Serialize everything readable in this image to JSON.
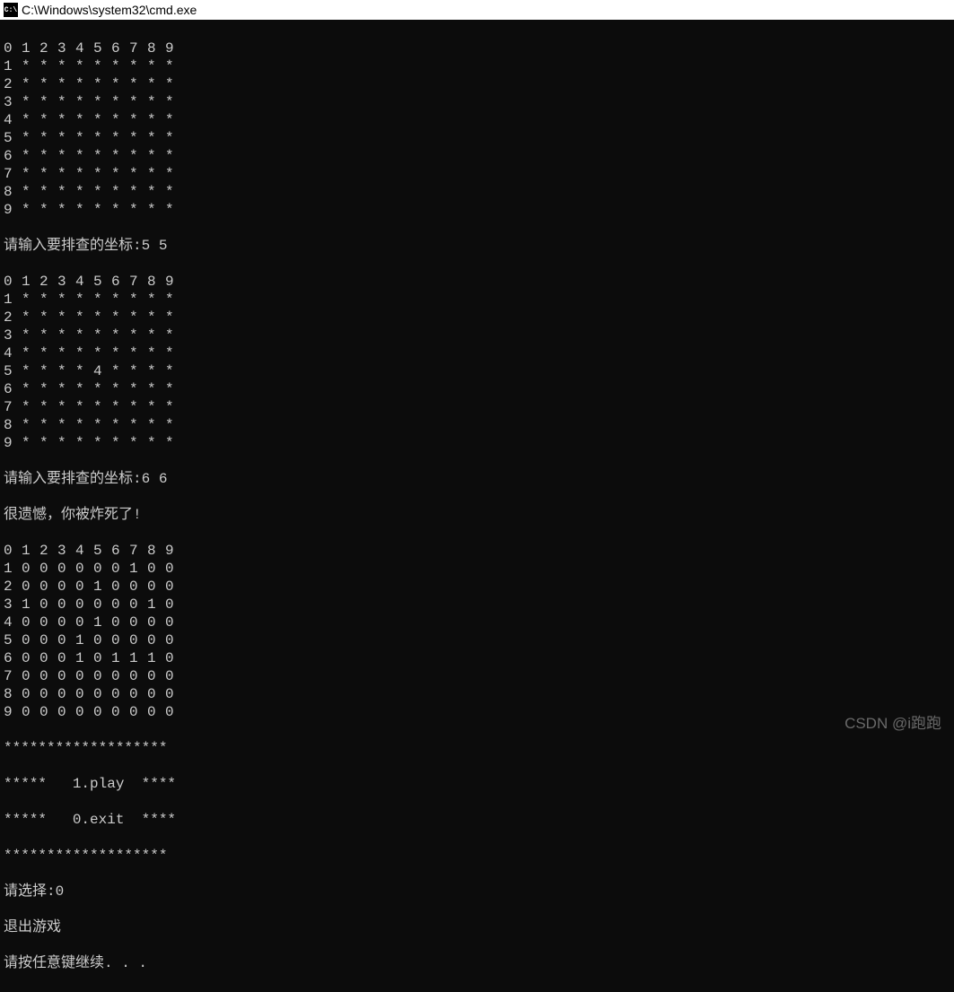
{
  "window": {
    "title": "C:\\Windows\\system32\\cmd.exe",
    "icon_label": "C:\\"
  },
  "grid1": {
    "header": [
      "0",
      "1",
      "2",
      "3",
      "4",
      "5",
      "6",
      "7",
      "8",
      "9"
    ],
    "rows": [
      [
        "1",
        "*",
        "*",
        "*",
        "*",
        "*",
        "*",
        "*",
        "*",
        "*"
      ],
      [
        "2",
        "*",
        "*",
        "*",
        "*",
        "*",
        "*",
        "*",
        "*",
        "*"
      ],
      [
        "3",
        "*",
        "*",
        "*",
        "*",
        "*",
        "*",
        "*",
        "*",
        "*"
      ],
      [
        "4",
        "*",
        "*",
        "*",
        "*",
        "*",
        "*",
        "*",
        "*",
        "*"
      ],
      [
        "5",
        "*",
        "*",
        "*",
        "*",
        "*",
        "*",
        "*",
        "*",
        "*"
      ],
      [
        "6",
        "*",
        "*",
        "*",
        "*",
        "*",
        "*",
        "*",
        "*",
        "*"
      ],
      [
        "7",
        "*",
        "*",
        "*",
        "*",
        "*",
        "*",
        "*",
        "*",
        "*"
      ],
      [
        "8",
        "*",
        "*",
        "*",
        "*",
        "*",
        "*",
        "*",
        "*",
        "*"
      ],
      [
        "9",
        "*",
        "*",
        "*",
        "*",
        "*",
        "*",
        "*",
        "*",
        "*"
      ]
    ]
  },
  "prompt1": {
    "label": "请输入要排查的坐标:",
    "input": "5 5"
  },
  "grid2": {
    "header": [
      "0",
      "1",
      "2",
      "3",
      "4",
      "5",
      "6",
      "7",
      "8",
      "9"
    ],
    "rows": [
      [
        "1",
        "*",
        "*",
        "*",
        "*",
        "*",
        "*",
        "*",
        "*",
        "*"
      ],
      [
        "2",
        "*",
        "*",
        "*",
        "*",
        "*",
        "*",
        "*",
        "*",
        "*"
      ],
      [
        "3",
        "*",
        "*",
        "*",
        "*",
        "*",
        "*",
        "*",
        "*",
        "*"
      ],
      [
        "4",
        "*",
        "*",
        "*",
        "*",
        "*",
        "*",
        "*",
        "*",
        "*"
      ],
      [
        "5",
        "*",
        "*",
        "*",
        "*",
        "4",
        "*",
        "*",
        "*",
        "*"
      ],
      [
        "6",
        "*",
        "*",
        "*",
        "*",
        "*",
        "*",
        "*",
        "*",
        "*"
      ],
      [
        "7",
        "*",
        "*",
        "*",
        "*",
        "*",
        "*",
        "*",
        "*",
        "*"
      ],
      [
        "8",
        "*",
        "*",
        "*",
        "*",
        "*",
        "*",
        "*",
        "*",
        "*"
      ],
      [
        "9",
        "*",
        "*",
        "*",
        "*",
        "*",
        "*",
        "*",
        "*",
        "*"
      ]
    ]
  },
  "prompt2": {
    "label": "请输入要排查的坐标:",
    "input": "6 6"
  },
  "gameover": "很遗憾，你被炸死了!",
  "grid3": {
    "header": [
      "0",
      "1",
      "2",
      "3",
      "4",
      "5",
      "6",
      "7",
      "8",
      "9"
    ],
    "rows": [
      [
        "1",
        "0",
        "0",
        "0",
        "0",
        "0",
        "0",
        "1",
        "0",
        "0"
      ],
      [
        "2",
        "0",
        "0",
        "0",
        "0",
        "1",
        "0",
        "0",
        "0",
        "0"
      ],
      [
        "3",
        "1",
        "0",
        "0",
        "0",
        "0",
        "0",
        "0",
        "1",
        "0"
      ],
      [
        "4",
        "0",
        "0",
        "0",
        "0",
        "1",
        "0",
        "0",
        "0",
        "0"
      ],
      [
        "5",
        "0",
        "0",
        "0",
        "1",
        "0",
        "0",
        "0",
        "0",
        "0"
      ],
      [
        "6",
        "0",
        "0",
        "0",
        "1",
        "0",
        "1",
        "1",
        "1",
        "0"
      ],
      [
        "7",
        "0",
        "0",
        "0",
        "0",
        "0",
        "0",
        "0",
        "0",
        "0"
      ],
      [
        "8",
        "0",
        "0",
        "0",
        "0",
        "0",
        "0",
        "0",
        "0",
        "0"
      ],
      [
        "9",
        "0",
        "0",
        "0",
        "0",
        "0",
        "0",
        "0",
        "0",
        "0"
      ]
    ]
  },
  "menu": {
    "border": "*******************",
    "option1": "*****   1.play  ****",
    "option2": "*****   0.exit  ****"
  },
  "prompt3": {
    "label": "请选择:",
    "input": "0"
  },
  "exit_msg": "退出游戏",
  "continue_msg": "请按任意键继续. . .",
  "watermark": "CSDN @i跑跑"
}
